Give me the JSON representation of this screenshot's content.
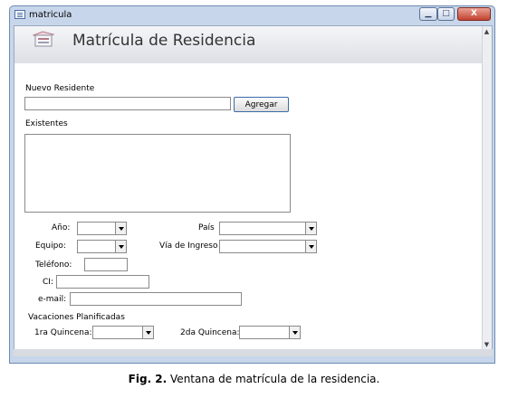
{
  "window": {
    "title": "matricula",
    "minimize_label": "▁",
    "maximize_label": "□",
    "close_label": "X"
  },
  "form": {
    "title": "Matrícula de Residencia",
    "nuevo_residente_label": "Nuevo Residente",
    "nuevo_residente_value": "",
    "agregar_label": "Agregar",
    "existentes_label": "Existentes",
    "ano_label": "Año:",
    "pais_label": "País",
    "equipo_label": "Equipo:",
    "via_ingreso_label": "Vía de Ingreso",
    "telefono_label": "Teléfono:",
    "ci_label": "CI:",
    "email_label": "e-mail:",
    "vacaciones_label": "Vacaciones Planificadas",
    "quincena1_label": "1ra Quincena:",
    "quincena2_label": "2da Quincena:"
  },
  "caption": {
    "prefix": "Fig. 2.",
    "text": " Ventana de matrícula de la residencia."
  },
  "colors": {
    "window_frame": "#c7d6ea",
    "header_band": "#dcdfe5",
    "button_border": "#3c6aa8"
  }
}
